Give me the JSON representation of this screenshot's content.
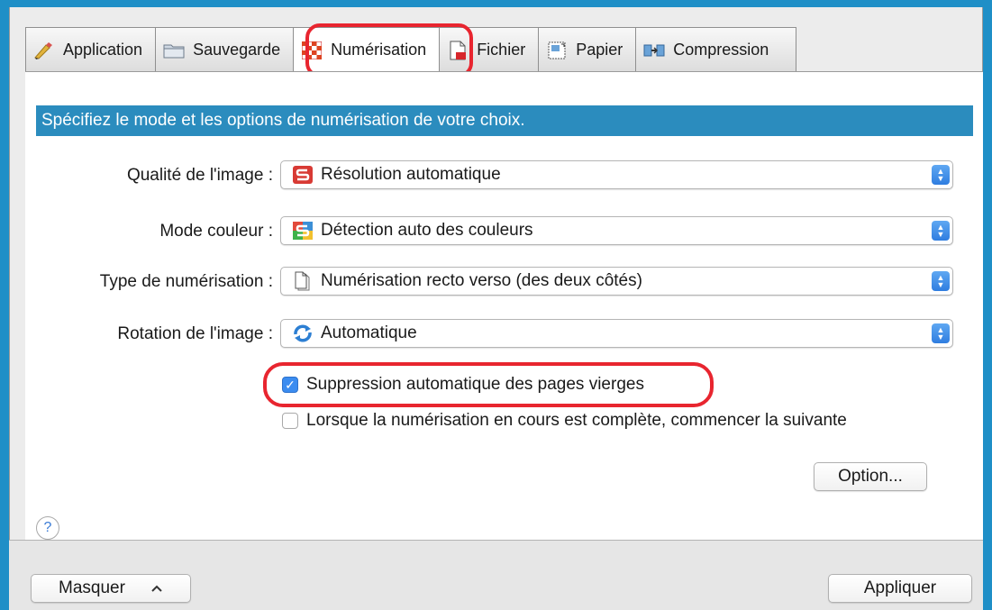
{
  "tabs": [
    {
      "label": "Application",
      "icon": "pen-icon"
    },
    {
      "label": "Sauvegarde",
      "icon": "folder-icon"
    },
    {
      "label": "Numérisation",
      "icon": "scan-checker-icon"
    },
    {
      "label": "Fichier",
      "icon": "file-pdf-icon"
    },
    {
      "label": "Papier",
      "icon": "paper-size-icon"
    },
    {
      "label": "Compression",
      "icon": "compression-icon"
    }
  ],
  "banner": "Spécifiez le mode et les options de numérisation de votre choix.",
  "settings": [
    {
      "label": "Qualité de l'image :",
      "value": "Résolution automatique",
      "icon": "scansnap-red-icon"
    },
    {
      "label": "Mode couleur :",
      "value": "Détection auto des couleurs",
      "icon": "scansnap-color-icon"
    },
    {
      "label": "Type de numérisation :",
      "value": "Numérisation recto verso (des deux côtés)",
      "icon": "document-icon"
    },
    {
      "label": "Rotation de l'image :",
      "value": "Automatique",
      "icon": "rotate-icon"
    }
  ],
  "checkboxes": [
    {
      "label": "Suppression automatique des pages vierges",
      "checked": true
    },
    {
      "label": "Lorsque la numérisation en cours est complète, commencer la suivante",
      "checked": false
    }
  ],
  "buttons": {
    "option": "Option...",
    "hide": "Masquer",
    "apply": "Appliquer",
    "help": "?"
  },
  "colors": {
    "accent": "#2b8cbe",
    "highlight": "#e8252f",
    "checkbox": "#3b8cf0"
  }
}
